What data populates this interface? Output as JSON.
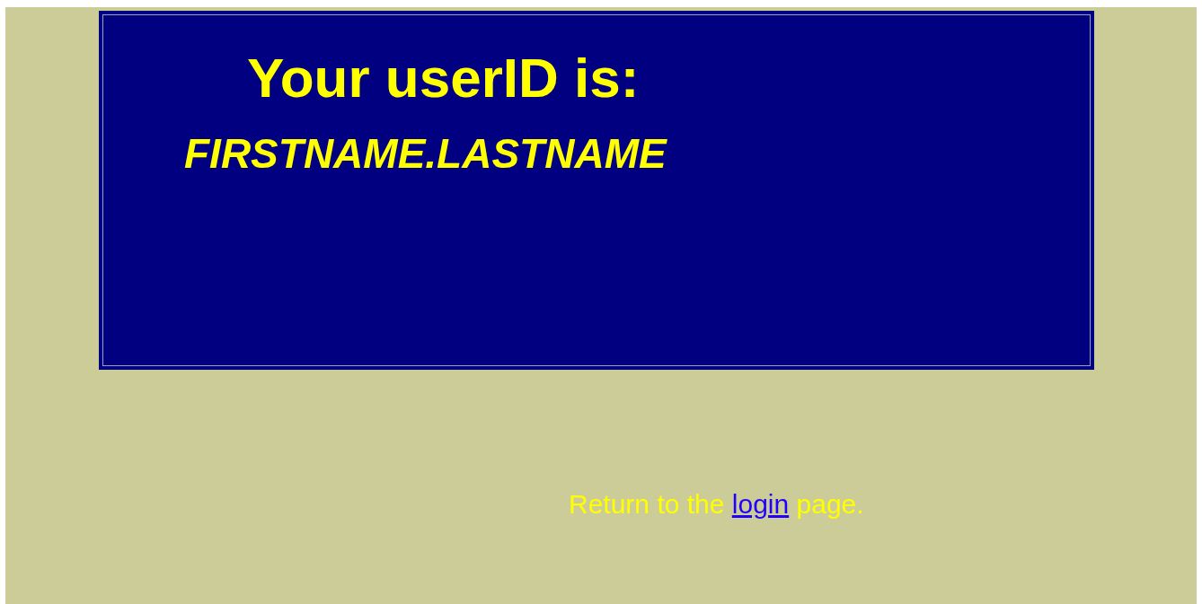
{
  "panel": {
    "heading": "Your userID is:",
    "user_id": "FIRSTNAME.LASTNAME"
  },
  "return_note": {
    "before": "Return to the",
    "link": "login",
    "after": "page."
  }
}
